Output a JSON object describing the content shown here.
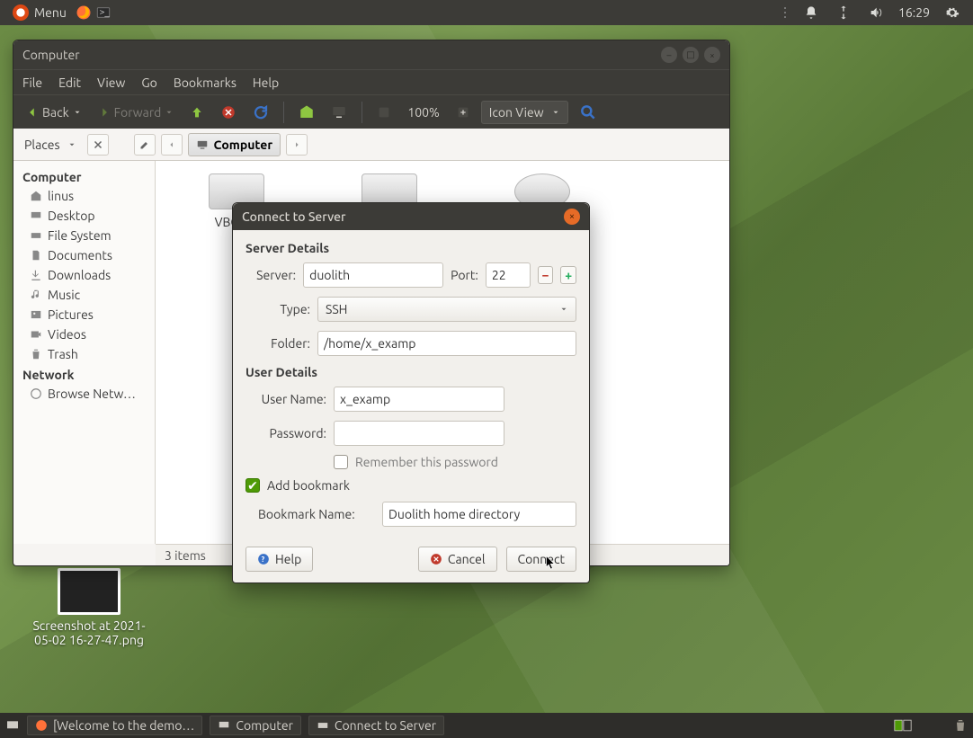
{
  "top_panel": {
    "menu": "Menu",
    "clock": "16:29"
  },
  "desktop": {
    "screenshot_label": "Screenshot at 2021-05-02 16-27-47.png"
  },
  "fm": {
    "title": "Computer",
    "menubar": [
      "File",
      "Edit",
      "View",
      "Go",
      "Bookmarks",
      "Help"
    ],
    "back": "Back",
    "forward": "Forward",
    "zoom": "100%",
    "view_mode": "Icon View",
    "places_label": "Places",
    "crumb": "Computer",
    "sidebar": {
      "computer_head": "Computer",
      "items": [
        "linus",
        "Desktop",
        "File System",
        "Documents",
        "Downloads",
        "Music",
        "Pictures",
        "Videos",
        "Trash"
      ],
      "network_head": "Network",
      "network_items": [
        "Browse Netw…"
      ]
    },
    "content_item": "VBOX C",
    "status": "3 items"
  },
  "dialog": {
    "title": "Connect to Server",
    "server_details": "Server Details",
    "server_label": "Server:",
    "server_value": "duolith",
    "port_label": "Port:",
    "port_value": "22",
    "type_label": "Type:",
    "type_value": "SSH",
    "folder_label": "Folder:",
    "folder_value": "/home/x_examp",
    "user_details": "User Details",
    "username_label": "User Name:",
    "username_value": "x_examp",
    "password_label": "Password:",
    "remember": "Remember this password",
    "add_bookmark": "Add bookmark",
    "bookmark_name_label": "Bookmark Name:",
    "bookmark_name_value": "Duolith home directory",
    "help": "Help",
    "cancel": "Cancel",
    "connect": "Connect"
  },
  "taskbar": {
    "items": [
      "[Welcome to the demo…",
      "Computer",
      "Connect to Server"
    ]
  }
}
